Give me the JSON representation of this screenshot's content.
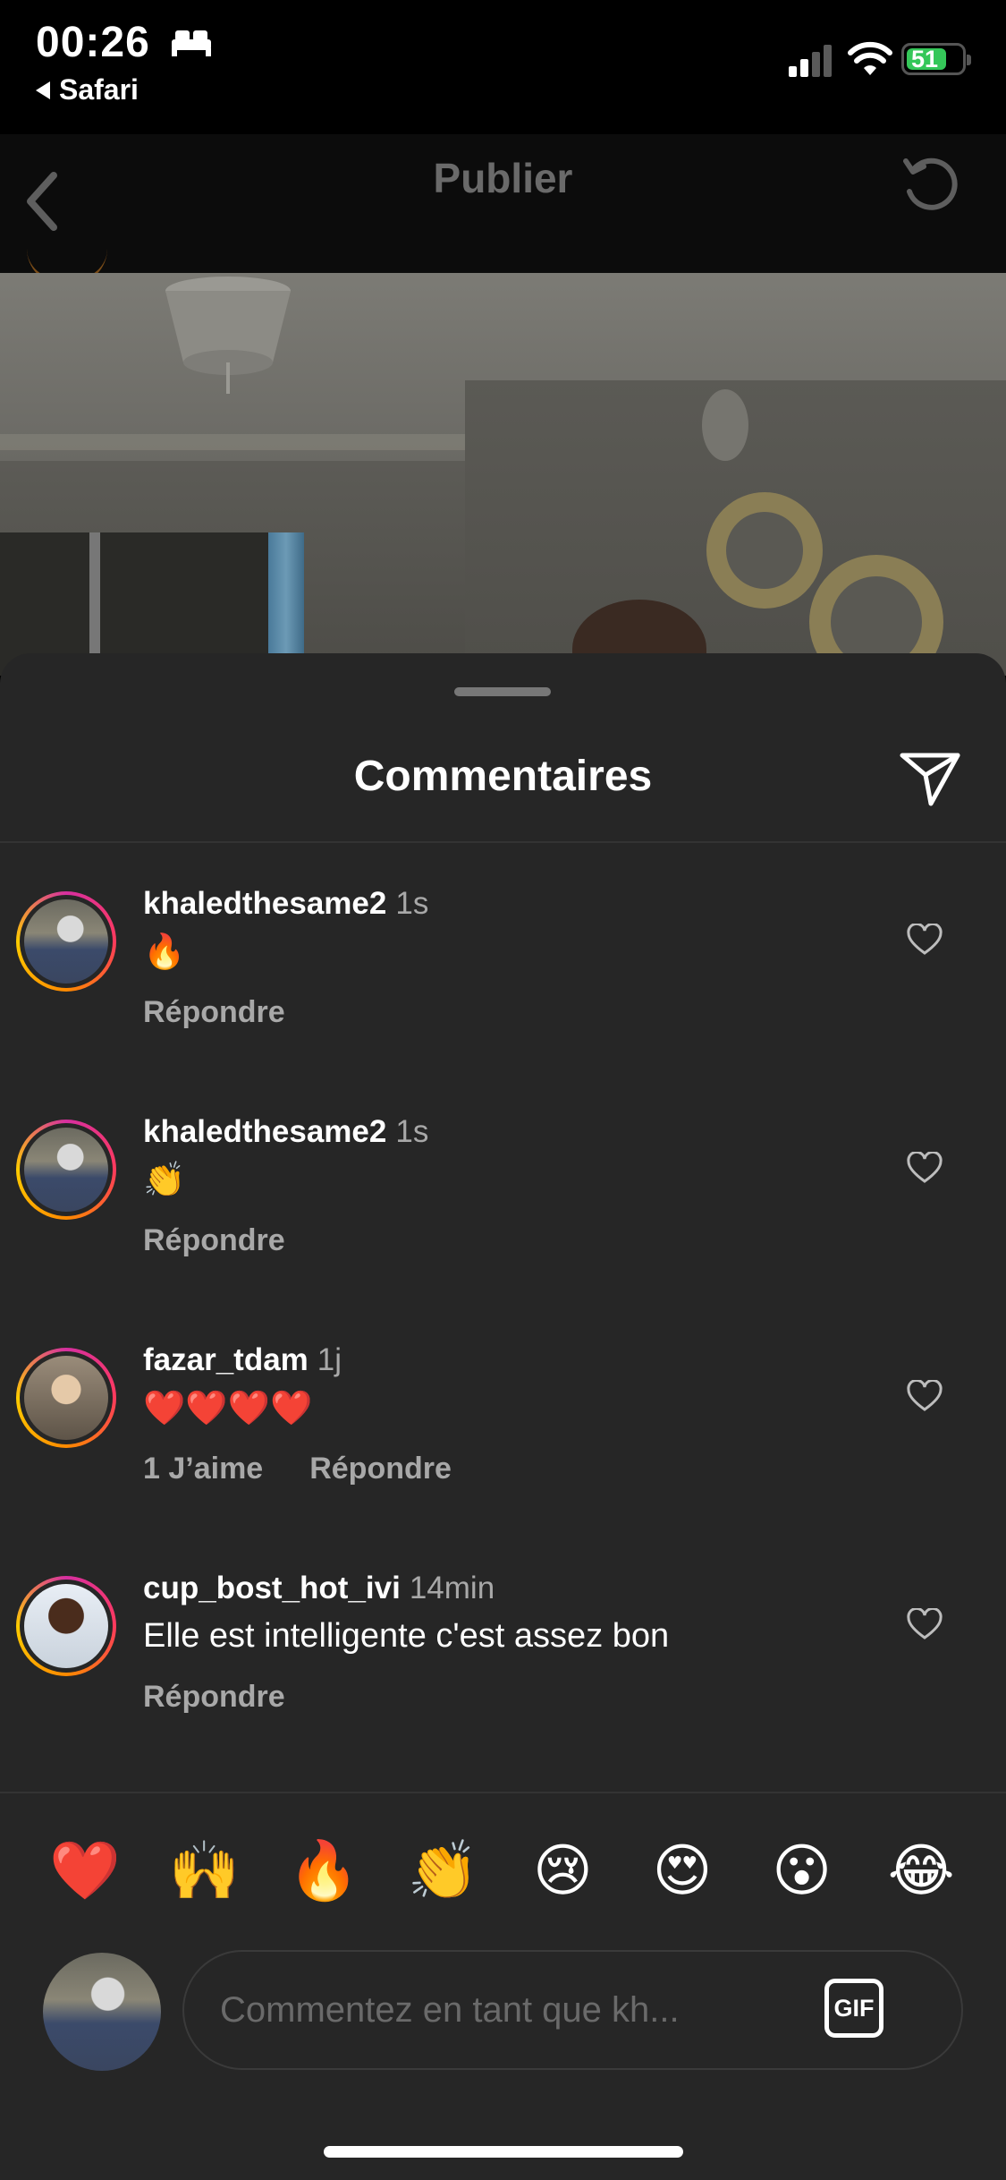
{
  "status_bar": {
    "time": "00:26",
    "back_app": "Safari",
    "battery": "51"
  },
  "nav": {
    "title": "Publier"
  },
  "sheet": {
    "title": "Commentaires"
  },
  "comments": [
    {
      "username": "khaledthesame2",
      "time": "1s",
      "text": "🔥",
      "likes": "",
      "reply": "Répondre"
    },
    {
      "username": "khaledthesame2",
      "time": "1s",
      "text": "👏",
      "likes": "",
      "reply": "Répondre"
    },
    {
      "username": "fazar_tdam",
      "time": "1j",
      "text": "❤️❤️❤️❤️",
      "likes": "1 J’aime",
      "reply": "Répondre"
    },
    {
      "username": "cup_bost_hot_ivi",
      "time": "14min",
      "text": "Elle est intelligente c'est assez bon",
      "likes": "",
      "reply": "Répondre"
    }
  ],
  "quick_reactions": [
    "❤️",
    "🙌",
    "🔥",
    "👏",
    "😢",
    "😍",
    "😮",
    "😂"
  ],
  "composer": {
    "placeholder": "Commentez en tant que kh...",
    "gif_label": "GIF"
  }
}
